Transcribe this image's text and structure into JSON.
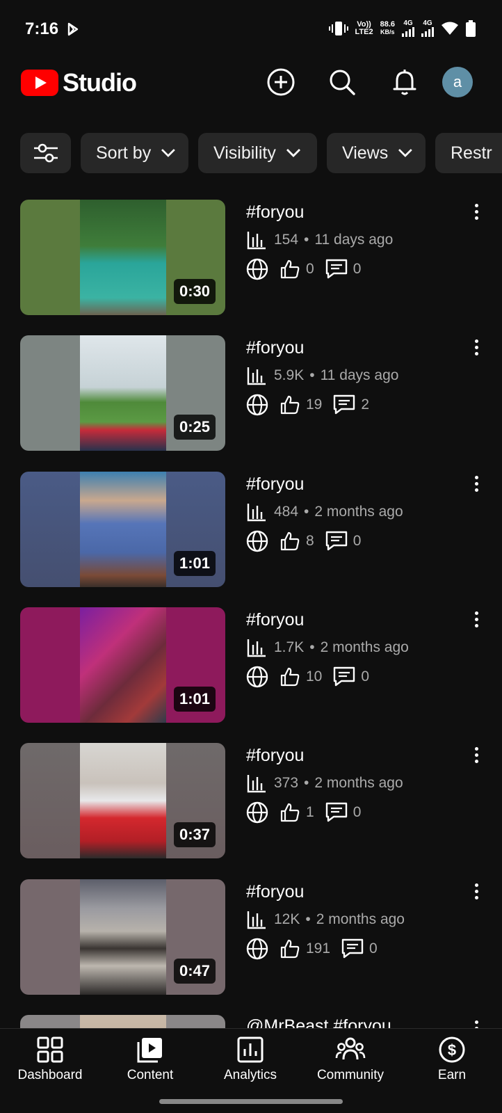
{
  "status": {
    "time": "7:16",
    "volte": "Vo))",
    "lte": "LTE2",
    "speed_value": "88.6",
    "speed_unit": "KB/s",
    "net1": "4G",
    "net2": "4G"
  },
  "app": {
    "logo_text": "Studio",
    "avatar_letter": "a",
    "accent_color": "#ff0000"
  },
  "filters": [
    {
      "label": "Sort by"
    },
    {
      "label": "Visibility"
    },
    {
      "label": "Views"
    },
    {
      "label": "Restr"
    }
  ],
  "videos": [
    {
      "title": "#foryou",
      "views": "154",
      "age": "11 days ago",
      "likes": "0",
      "comments": "0",
      "duration": "0:30"
    },
    {
      "title": "#foryou",
      "views": "5.9K",
      "age": "11 days ago",
      "likes": "19",
      "comments": "2",
      "duration": "0:25"
    },
    {
      "title": "#foryou",
      "views": "484",
      "age": "2 months ago",
      "likes": "8",
      "comments": "0",
      "duration": "1:01"
    },
    {
      "title": "#foryou",
      "views": "1.7K",
      "age": "2 months ago",
      "likes": "10",
      "comments": "0",
      "duration": "1:01"
    },
    {
      "title": "#foryou",
      "views": "373",
      "age": "2 months ago",
      "likes": "1",
      "comments": "0",
      "duration": "0:37"
    },
    {
      "title": "#foryou",
      "views": "12K",
      "age": "2 months ago",
      "likes": "191",
      "comments": "0",
      "duration": "0:47"
    },
    {
      "title": "@MrBeast #foryou"
    }
  ],
  "nav": [
    {
      "label": "Dashboard",
      "icon": "dashboard-icon"
    },
    {
      "label": "Content",
      "icon": "content-icon"
    },
    {
      "label": "Analytics",
      "icon": "analytics-icon"
    },
    {
      "label": "Community",
      "icon": "community-icon"
    },
    {
      "label": "Earn",
      "icon": "earn-icon"
    }
  ]
}
